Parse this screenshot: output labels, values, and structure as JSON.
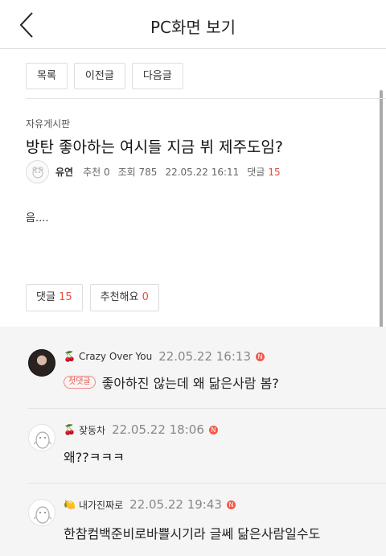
{
  "header": {
    "title": "PC화면 보기"
  },
  "nav": {
    "list": "목록",
    "prev": "이전글",
    "next": "다음글"
  },
  "post": {
    "board": "자유게시판",
    "title": "방탄 좋아하는 여시들 지금 뷔 제주도임?",
    "author": "유연",
    "recommend": "추천 0",
    "views": "조회 785",
    "date": "22.05.22 16:11",
    "comment_label": "댓글",
    "comment_count": "15",
    "body": "음...."
  },
  "actions": {
    "comment_label": "댓글",
    "comment_count": "15",
    "recommend_label": "추천해요",
    "recommend_count": "0"
  },
  "comments": [
    {
      "emoji": "🍒",
      "name": "Crazy Over You",
      "date": "22.05.22 16:13",
      "badge": "첫댓글",
      "text": "좋아하진 않는데 왜 닮은사람 봄?"
    },
    {
      "emoji": "🍒",
      "name": "잦동차",
      "date": "22.05.22 18:06",
      "text": "왜??ㅋㅋㅋ"
    },
    {
      "emoji": "🍋",
      "name": "내가진짜로",
      "date": "22.05.22 19:43",
      "text": "한참컴백준비로바쁠시기라 글쎄 닮은사람일수도"
    }
  ],
  "new_badge": "N"
}
